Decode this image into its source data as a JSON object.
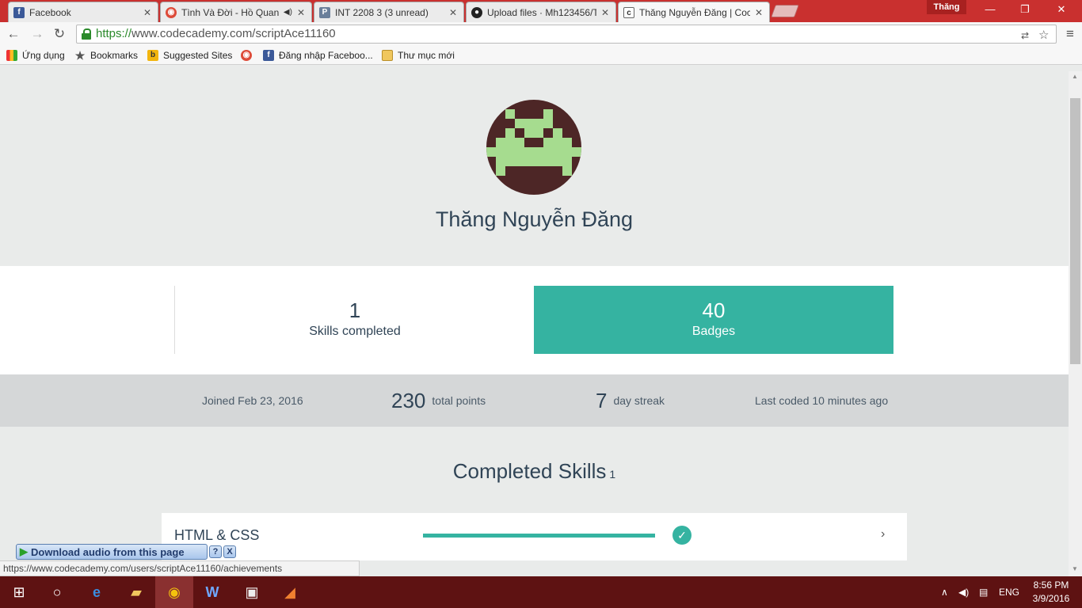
{
  "browser": {
    "tabs": [
      {
        "label": "Facebook",
        "icon": "facebook-icon",
        "color": "#3b5998",
        "glyph": "f"
      },
      {
        "label": "Tình Và Đời - Hồ Quan",
        "icon": "chrome-audio-icon",
        "color": "#dd4b39",
        "glyph": "◉",
        "extra": "🔊"
      },
      {
        "label": "INT 2208 3 (3 unread)",
        "icon": "p-icon",
        "color": "#6a7f9a",
        "glyph": "P"
      },
      {
        "label": "Upload files · Mh123456/T",
        "icon": "github-icon",
        "color": "#222",
        "glyph": "●"
      },
      {
        "label": "Thăng Nguyễn Đăng | Coc",
        "icon": "codecademy-icon",
        "color": "#fff",
        "glyph": "c"
      }
    ],
    "profile_name": "Thăng",
    "url_scheme": "https://",
    "url_rest": "www.codecademy.com/scriptAce11160",
    "bookmarks": [
      {
        "label": "Ứng dụng",
        "icon": "apps-grid-icon"
      },
      {
        "label": "Bookmarks",
        "icon": "star-icon"
      },
      {
        "label": "Suggested Sites",
        "icon": "bing-icon"
      },
      {
        "label": "",
        "icon": "chrome-icon"
      },
      {
        "label": "Đăng nhập Faceboo...",
        "icon": "facebook-icon"
      },
      {
        "label": "Thư mục mới",
        "icon": "folder-icon"
      }
    ],
    "status_url": "https://www.codecademy.com/users/scriptAce11160/achievements"
  },
  "profile": {
    "name": "Thăng Nguyễn Đăng",
    "skills_count": "1",
    "skills_label": "Skills completed",
    "badges_count": "40",
    "badges_label": "Badges",
    "joined": "Joined Feb 23, 2016",
    "points": "230",
    "points_label": "total points",
    "streak": "7",
    "streak_label": "day streak",
    "last_coded": "Last coded 10 minutes ago"
  },
  "completed_skills": {
    "title": "Completed Skills",
    "count": "1",
    "items": [
      {
        "name": "HTML & CSS",
        "progress": 1.0,
        "chevron": "›"
      }
    ]
  },
  "overlay": {
    "download_label": "Download audio from this page",
    "help": "?",
    "close": "X"
  },
  "taskbar": {
    "lang": "ENG",
    "time": "8:56 PM",
    "date": "3/9/2016"
  },
  "colors": {
    "accent": "#35b3a1",
    "text": "#304456",
    "chrome_red": "#c9302f"
  }
}
